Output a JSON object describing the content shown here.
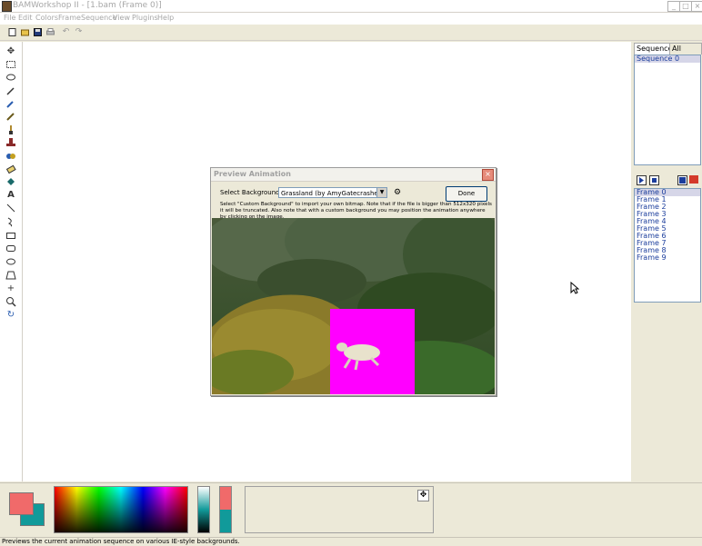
{
  "window": {
    "title": "BAMWorkshop II - [1.bam (Frame 0)]",
    "minimize": "_",
    "maximize": "□",
    "close": "×"
  },
  "menu": [
    "File",
    "Edit",
    "Colors",
    "Frame",
    "Sequence",
    "View",
    "Plugins",
    "Help"
  ],
  "toolbar": {
    "icons": [
      "new-icon",
      "open-icon",
      "save-icon",
      "print-icon",
      "undo-icon",
      "redo-icon"
    ]
  },
  "tools": [
    "move-icon",
    "rect-select-icon",
    "lasso-icon",
    "magic-wand-icon",
    "eyedropper-icon",
    "pencil-icon",
    "brush-icon",
    "stamp-icon",
    "replace-color-icon",
    "eraser-icon",
    "fill-icon",
    "text-icon",
    "line-icon",
    "curve-icon",
    "rectangle-icon",
    "rounded-rect-icon",
    "ellipse-icon",
    "polygon-icon",
    "crosshair-icon",
    "zoom-icon",
    "rotate-icon"
  ],
  "right_panel": {
    "tabs": [
      "Sequences",
      "All Frames"
    ],
    "sequences": [
      "Sequence 0"
    ],
    "frames": [
      "Frame 0",
      "Frame 1",
      "Frame 2",
      "Frame 3",
      "Frame 4",
      "Frame 5",
      "Frame 6",
      "Frame 7",
      "Frame 8",
      "Frame 9"
    ]
  },
  "dialog": {
    "title": "Preview Animation",
    "select_label": "Select Background:",
    "background_value": "Grassland (by AmyGatecrasher)",
    "done_label": "Done",
    "close": "×",
    "note": "Select \"Custom Background\" to import your own bitmap. Note that if the file is bigger than 512x320 pixels it will be truncated. Also note that with a custom background you may position the animation anywhere by clicking on the image."
  },
  "colors": {
    "foreground": "#f06a6a",
    "background": "#119a9a",
    "sprite_bg": "#ff00ff"
  },
  "status": "Previews the current animation sequence on various IE-style backgrounds."
}
